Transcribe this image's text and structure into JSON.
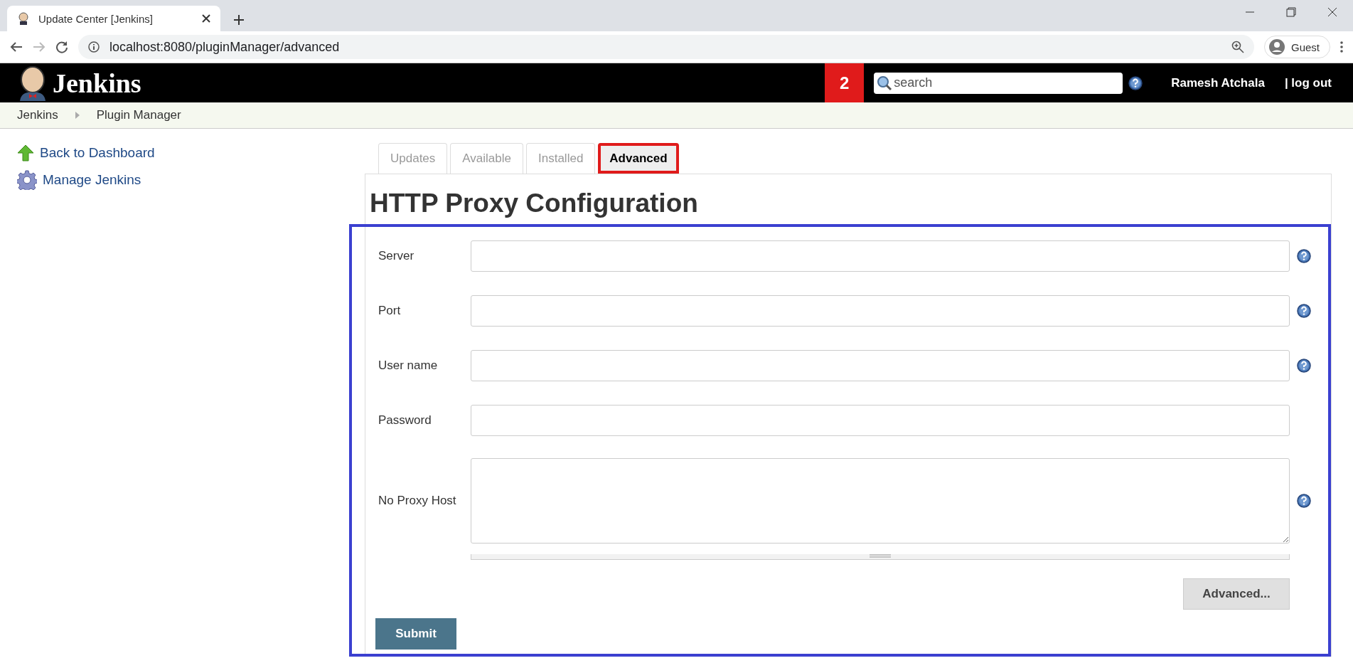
{
  "browser": {
    "tab_title": "Update Center [Jenkins]",
    "url": "localhost:8080/pluginManager/advanced",
    "profile": "Guest"
  },
  "header": {
    "logo": "Jenkins",
    "badge": "2",
    "search": {
      "placeholder": "search"
    },
    "user": "Ramesh Atchala",
    "logout": "| log out"
  },
  "breadcrumbs": [
    "Jenkins",
    "Plugin Manager"
  ],
  "sidebar": {
    "items": [
      {
        "label": "Back to Dashboard",
        "kind": "up"
      },
      {
        "label": "Manage Jenkins",
        "kind": "gear"
      }
    ]
  },
  "tabs": [
    {
      "label": "Updates",
      "selected": false
    },
    {
      "label": "Available",
      "selected": false
    },
    {
      "label": "Installed",
      "selected": false
    },
    {
      "label": "Advanced",
      "selected": true
    }
  ],
  "heading": "HTTP Proxy Configuration",
  "fields": [
    {
      "label": "Server",
      "kind": "input",
      "help": true
    },
    {
      "label": "Port",
      "kind": "input",
      "help": true
    },
    {
      "label": "User name",
      "kind": "input",
      "help": true
    },
    {
      "label": "Password",
      "kind": "password",
      "help": false
    },
    {
      "label": "No Proxy Host",
      "kind": "textarea",
      "help": true
    }
  ],
  "advanced_button": "Advanced...",
  "submit_button": "Submit"
}
